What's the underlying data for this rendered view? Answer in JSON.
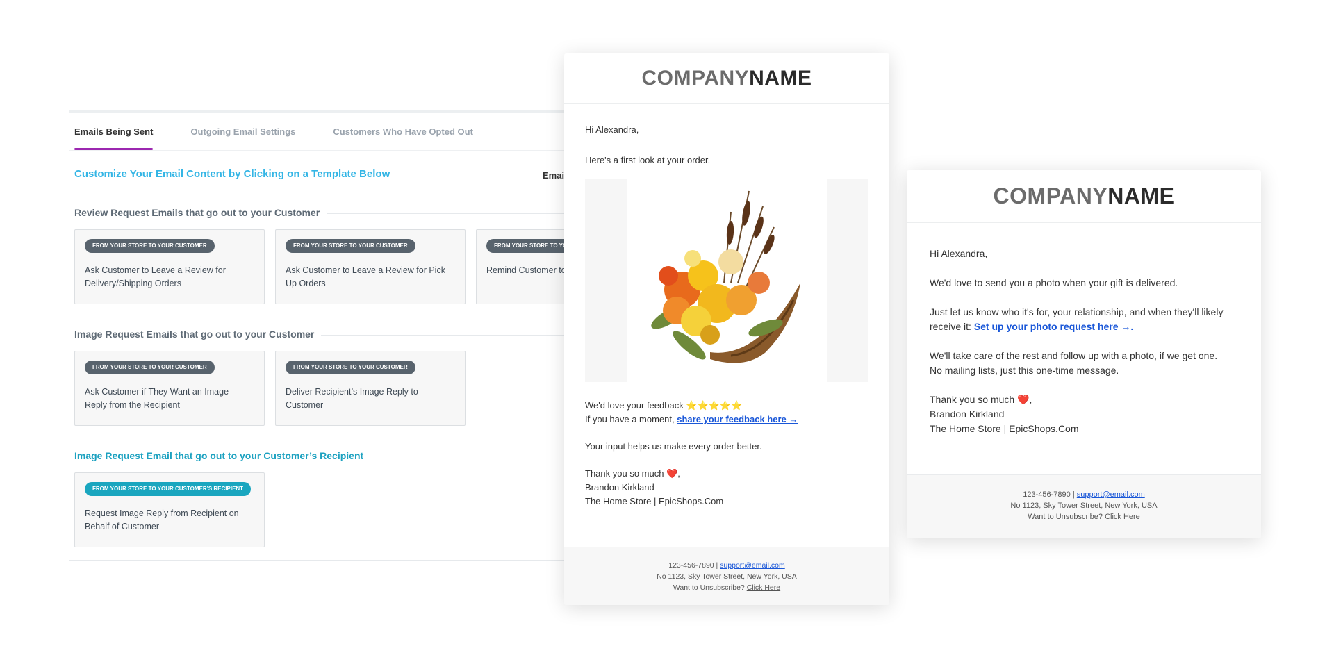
{
  "tabs": {
    "emails_being_sent": "Emails Being Sent",
    "outgoing_settings": "Outgoing Email Settings",
    "opted_out": "Customers Who Have Opted Out"
  },
  "heading": "Customize Your Email Content by Clicking on a Template Below",
  "email_label": "Email",
  "sections": {
    "review": "Review Request Emails that go out to your Customer",
    "image_customer": "Image Request Emails that go out to your Customer",
    "image_recipient": "Image Request Email that go out to your Customer’s Recipient"
  },
  "cards": [
    {
      "tag": "FROM YOUR STORE TO YOUR CUSTOMER",
      "text": "Ask Customer to Leave a Review for Delivery/Shipping Orders"
    },
    {
      "tag": "FROM YOUR STORE TO YOUR CUSTOMER",
      "text": "Ask Customer to Leave a Review for Pick Up Orders"
    },
    {
      "tag": "FROM YOUR STORE TO YOUR CUSTOMER",
      "text": "Remind Customer to"
    },
    {
      "tag": "FROM YOUR STORE TO YOUR CUSTOMER",
      "text": "Ask Customer if They Want an Image Reply from the Recipient"
    },
    {
      "tag": "FROM YOUR STORE TO YOUR CUSTOMER",
      "text": "Deliver Recipient’s Image Reply to Customer"
    },
    {
      "tag": "FROM YOUR STORE TO YOUR CUSTOMER’S RECIPIENT",
      "text": "Request Image Reply from Recipient on Behalf of Customer"
    }
  ],
  "email1": {
    "logo_a": "COMPANY",
    "logo_b": "NAME",
    "greeting": "Hi Alexandra,",
    "line1": "Here's a first look at your order.",
    "feedback_line": "We'd love your feedback ⭐⭐⭐⭐⭐",
    "moment_prefix": "If you have a moment, ",
    "feedback_link": "share your feedback here →",
    "input_line": "Your input helps us make every order better.",
    "thanks": "Thank you so much ❤️,",
    "name": "Brandon Kirkland",
    "store": "The Home Store | EpicShops.Com",
    "footer": {
      "phone": "123-456-7890 | ",
      "email": "support@email.com",
      "address": "No 1123, Sky Tower Street, New York, USA",
      "unsub_prefix": "Want to Unsubscribe? ",
      "unsub_link": "Click Here"
    }
  },
  "email2": {
    "logo_a": "COMPANY",
    "logo_b": "NAME",
    "greeting": "Hi Alexandra,",
    "line1": "We'd love to send you a photo when your gift is delivered.",
    "line2a": "Just let us know who it's for, your relationship, and when they'll likely",
    "line2b_prefix": "receive it: ",
    "photo_link": "Set up your photo request here →.",
    "line3a": "We'll take care of the rest and follow up with a photo, if we get one.",
    "line3b": "No mailing lists, just this one-time message.",
    "thanks": "Thank you so much ❤️,",
    "name": "Brandon Kirkland",
    "store": "The Home Store | EpicShops.Com",
    "footer": {
      "phone": "123-456-7890 | ",
      "email": "support@email.com",
      "address": "No 1123, Sky Tower Street, New York, USA",
      "unsub_prefix": "Want to Unsubscribe? ",
      "unsub_link": "Click Here"
    }
  }
}
